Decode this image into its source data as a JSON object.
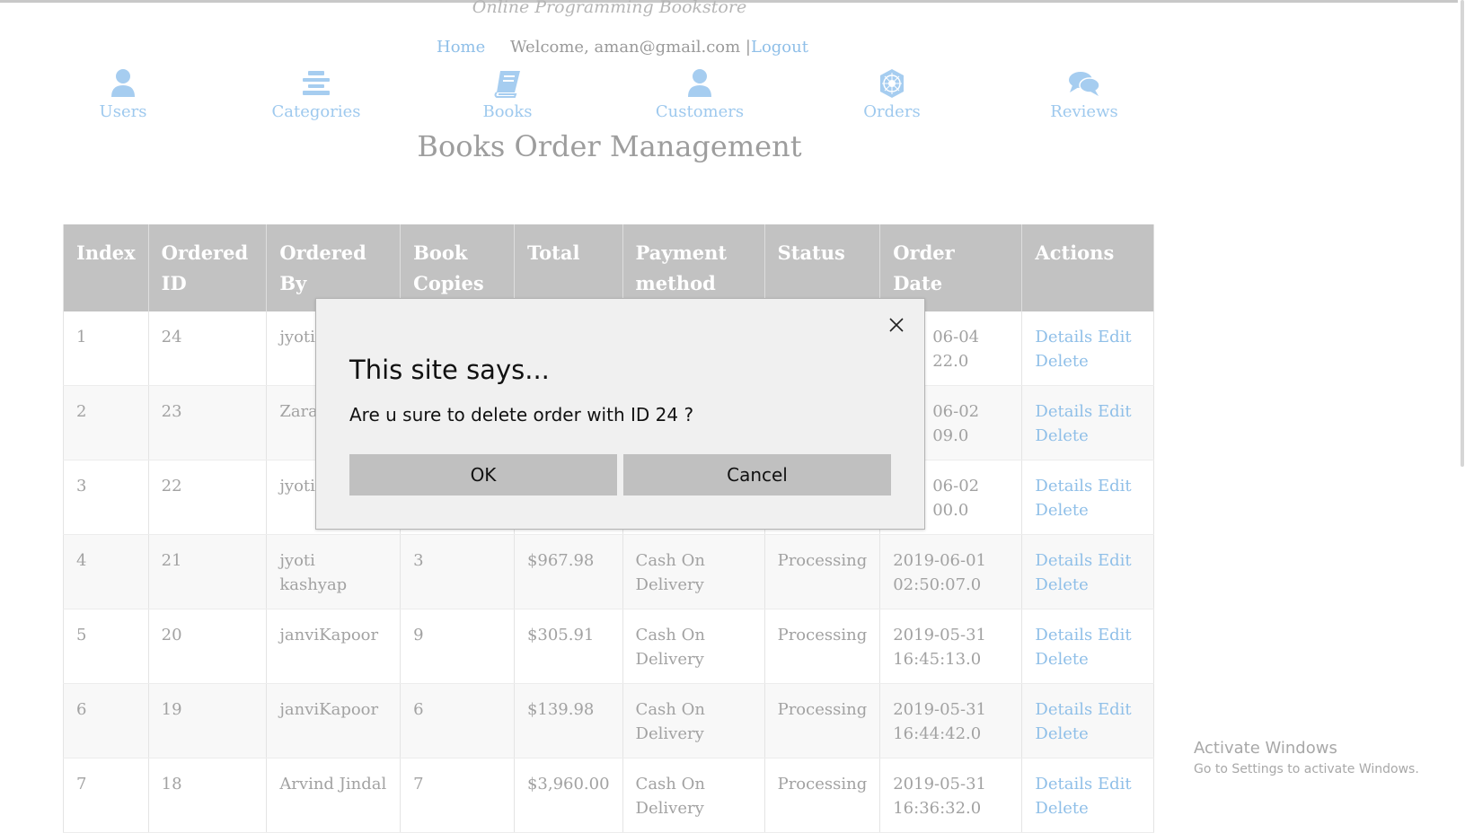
{
  "site": {
    "title": "Online Programming Bookstore"
  },
  "header": {
    "home_label": "Home",
    "welcome_text": "Welcome, aman@gmail.com |",
    "logout_label": "Logout"
  },
  "nav": {
    "items": [
      {
        "label": "Users",
        "icon": "user-icon"
      },
      {
        "label": "Categories",
        "icon": "list-icon"
      },
      {
        "label": "Books",
        "icon": "book-icon"
      },
      {
        "label": "Customers",
        "icon": "user-icon"
      },
      {
        "label": "Orders",
        "icon": "orders-icon"
      },
      {
        "label": "Reviews",
        "icon": "comments-icon"
      }
    ]
  },
  "page": {
    "title": "Books Order Management"
  },
  "table": {
    "headers": [
      "Index",
      "Ordered ID",
      "Ordered By",
      "Book Copies",
      "Total",
      "Payment method",
      "Status",
      "Order Date",
      "Actions"
    ],
    "action_labels": {
      "details": "Details",
      "edit": "Edit",
      "delete": "Delete"
    },
    "rows": [
      {
        "index": "1",
        "id": "24",
        "by": "jyotiK",
        "copies": "",
        "total": "",
        "payment": "",
        "status": "",
        "date": "06-04",
        "time": "22.0"
      },
      {
        "index": "2",
        "id": "23",
        "by": "Zara",
        "copies": "",
        "total": "",
        "payment": "",
        "status": "",
        "date": "06-02",
        "time": "09.0"
      },
      {
        "index": "3",
        "id": "22",
        "by": "jyotiK",
        "copies": "",
        "total": "",
        "payment": "",
        "status": "",
        "date": "06-02",
        "time": "00.0"
      },
      {
        "index": "4",
        "id": "21",
        "by": "jyoti kashyap",
        "copies": "3",
        "total": "$967.98",
        "payment": "Cash On Delivery",
        "status": "Processing",
        "date": "2019-06-01",
        "time": "02:50:07.0"
      },
      {
        "index": "5",
        "id": "20",
        "by": "janviKapoor",
        "copies": "9",
        "total": "$305.91",
        "payment": "Cash On Delivery",
        "status": "Processing",
        "date": "2019-05-31",
        "time": "16:45:13.0"
      },
      {
        "index": "6",
        "id": "19",
        "by": "janviKapoor",
        "copies": "6",
        "total": "$139.98",
        "payment": "Cash On Delivery",
        "status": "Processing",
        "date": "2019-05-31",
        "time": "16:44:42.0"
      },
      {
        "index": "7",
        "id": "18",
        "by": "Arvind Jindal",
        "copies": "7",
        "total": "$3,960.00",
        "payment": "Cash On Delivery",
        "status": "Processing",
        "date": "2019-05-31",
        "time": "16:36:32.0"
      }
    ]
  },
  "dialog": {
    "title": "This site says...",
    "message": "Are u sure to delete order with ID 24 ?",
    "ok_label": "OK",
    "cancel_label": "Cancel",
    "close_icon": "close-icon"
  },
  "watermark": {
    "line1": "Activate Windows",
    "line2": "Go to Settings to activate Windows."
  },
  "colors": {
    "link": "#8fbfe8",
    "nav_icon": "#a6cdf0",
    "table_header_bg": "#c2c2c2",
    "dialog_bg": "#f0f0f0",
    "dialog_button_bg": "#c0c0c0"
  }
}
